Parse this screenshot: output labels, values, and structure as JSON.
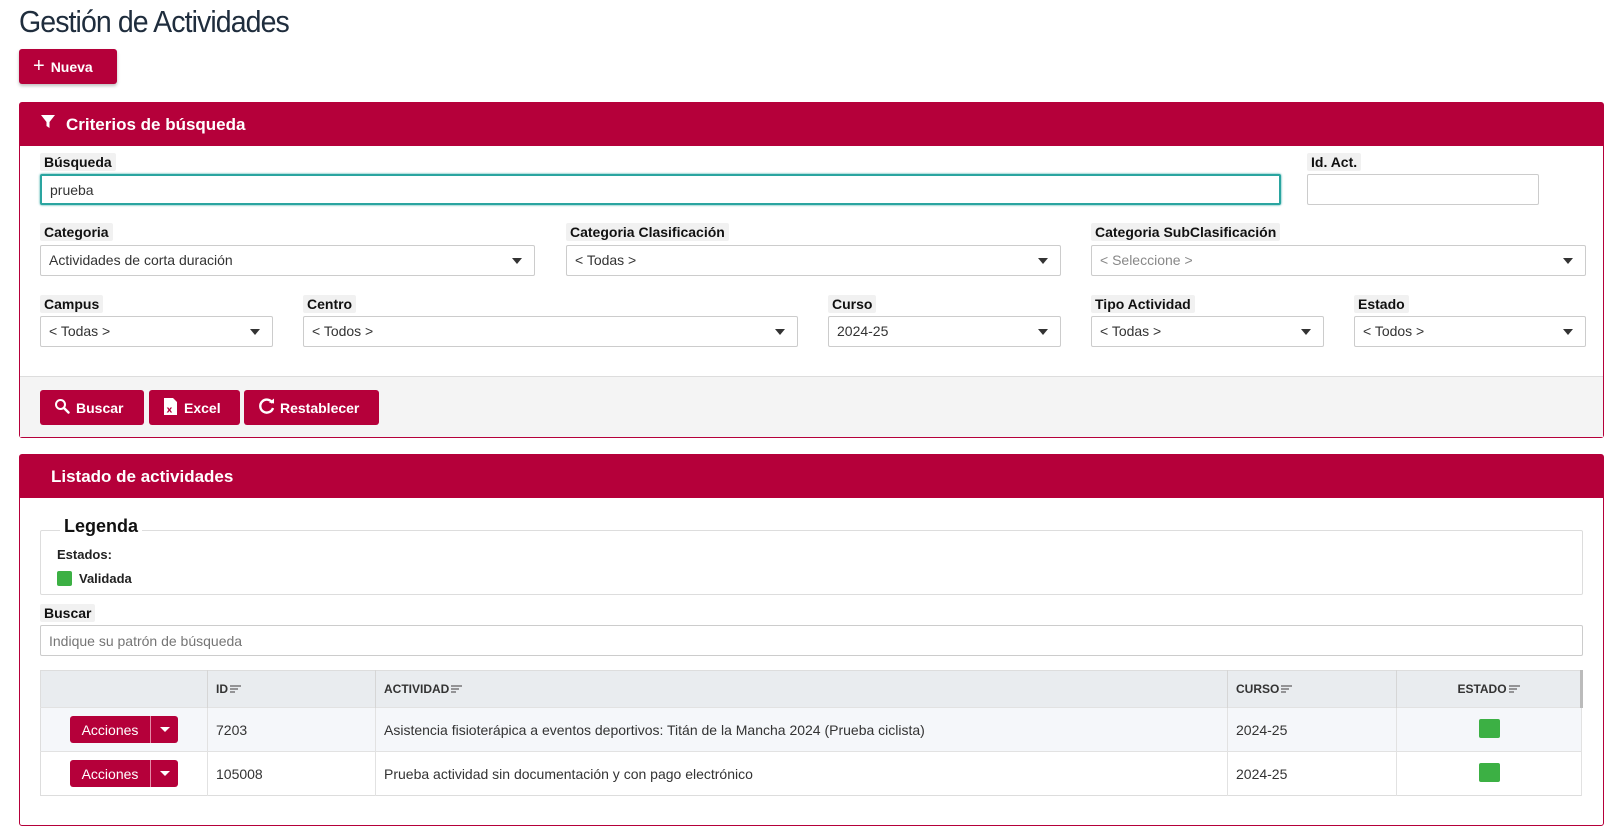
{
  "page_title": "Gestión de Actividades",
  "new_button": "Nueva",
  "accent_color": "#b5003a",
  "search_panel": {
    "header": "Criterios de búsqueda",
    "busqueda_label": "Búsqueda",
    "busqueda_value": "prueba",
    "idact_label": "Id. Act.",
    "idact_value": "",
    "categoria_label": "Categoria",
    "categoria_value": "Actividades de corta duración",
    "cat_clas_label": "Categoria Clasificación",
    "cat_clas_value": "< Todas >",
    "cat_subclas_label": "Categoria SubClasificación",
    "cat_subclas_value": "< Seleccione >",
    "campus_label": "Campus",
    "campus_value": "< Todas >",
    "centro_label": "Centro",
    "centro_value": "< Todos >",
    "curso_label": "Curso",
    "curso_value": "2024-25",
    "tipo_label": "Tipo Actividad",
    "tipo_value": "< Todas >",
    "estado_label": "Estado",
    "estado_value": "< Todos >",
    "buscar_button": "Buscar",
    "excel_button": "Excel",
    "reset_button": "Restablecer"
  },
  "list_panel": {
    "header": "Listado de actividades",
    "legend_title": "Legenda",
    "legend_estados": "Estados:",
    "legend_validada": "Validada",
    "validada_color": "#3cb044",
    "buscar_label": "Buscar",
    "buscar_placeholder": "Indique su patrón de búsqueda",
    "columns": {
      "id": "ID",
      "actividad": "ACTIVIDAD",
      "curso": "CURSO",
      "estado": "ESTADO"
    },
    "acciones_label": "Acciones",
    "rows": [
      {
        "id": "7203",
        "actividad": "Asistencia fisioterápica a eventos deportivos: Titán de la Mancha 2024 (Prueba ciclista)",
        "curso": "2024-25",
        "estado": "Validada"
      },
      {
        "id": "105008",
        "actividad": "Prueba actividad sin documentación y con pago electrónico",
        "curso": "2024-25",
        "estado": "Validada"
      }
    ]
  }
}
